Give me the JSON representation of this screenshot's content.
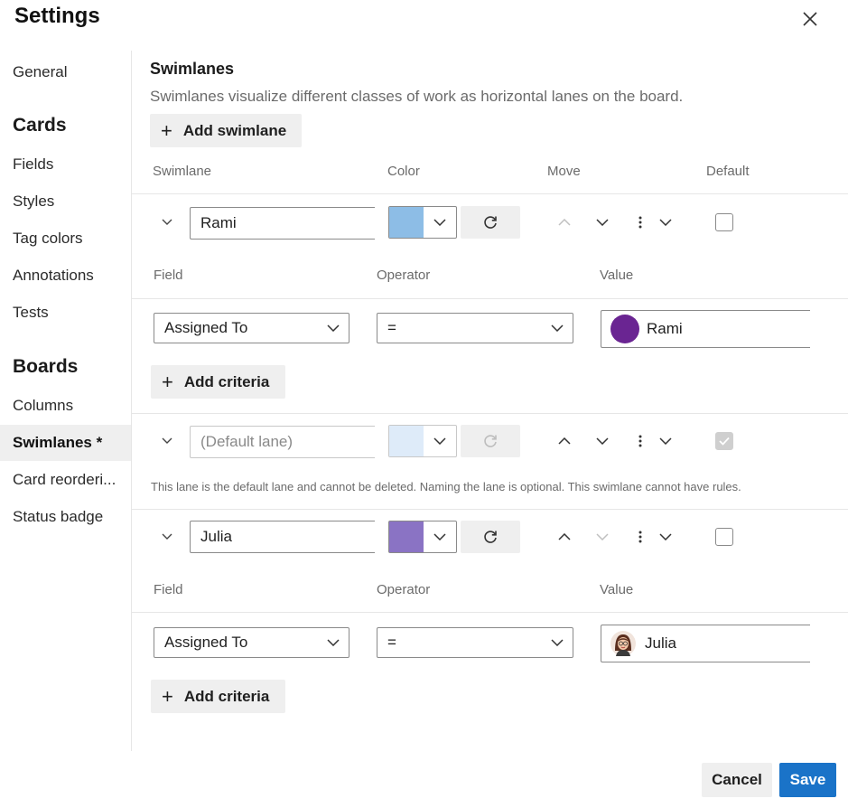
{
  "dialog": {
    "title": "Settings",
    "close_icon": "close-icon"
  },
  "sidebar": {
    "general": "General",
    "cards_heading": "Cards",
    "cards_items": [
      "Fields",
      "Styles",
      "Tag colors",
      "Annotations",
      "Tests"
    ],
    "boards_heading": "Boards",
    "boards_items": [
      "Columns",
      "Swimlanes *",
      "Card reorderi...",
      "Status badge"
    ],
    "active_item": "Swimlanes *"
  },
  "section": {
    "title": "Swimlanes",
    "description": "Swimlanes visualize different classes of work as horizontal lanes on the board.",
    "add_swimlane": "Add swimlane"
  },
  "columns": {
    "swimlane": "Swimlane",
    "color": "Color",
    "move": "Move",
    "default": "Default"
  },
  "criteria_columns": {
    "field": "Field",
    "operator": "Operator",
    "value": "Value"
  },
  "lanes": [
    {
      "name": "Rami",
      "color": "#8dbde6",
      "default": false,
      "criteria": {
        "field": "Assigned To",
        "operator": "=",
        "value": "Rami",
        "avatar_color": "#6a2592"
      },
      "add_criteria": "Add criteria"
    },
    {
      "name": "",
      "placeholder": "(Default lane)",
      "color": "#deebf9",
      "default": true,
      "note": "This lane is the default lane and cannot be deleted. Naming the lane is optional. This swimlane cannot have rules."
    },
    {
      "name": "Julia",
      "color": "#8a73c4",
      "default": false,
      "criteria": {
        "field": "Assigned To",
        "operator": "=",
        "value": "Julia",
        "avatar_icon": "user-avatar-icon"
      },
      "add_criteria": "Add criteria"
    }
  ],
  "footer": {
    "cancel": "Cancel",
    "save": "Save"
  },
  "colors": {
    "accent": "#1a73c8",
    "button_gray": "#efefef"
  }
}
